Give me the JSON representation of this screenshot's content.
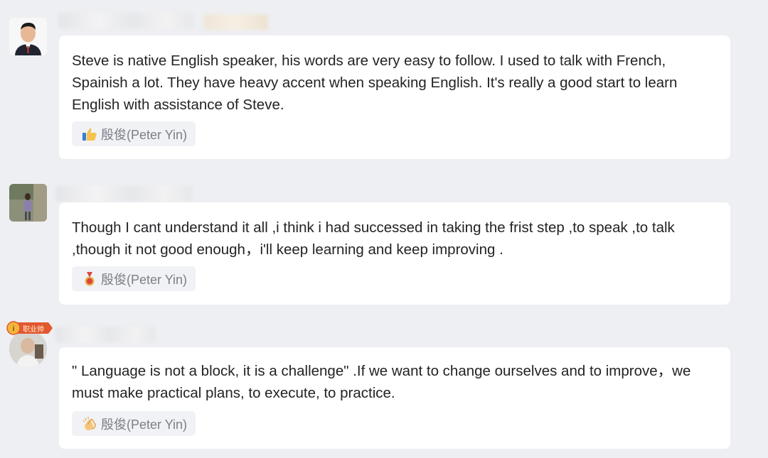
{
  "comments": [
    {
      "text": "Steve is native English speaker, his words are very easy to follow. I used to talk with French, Spainish a lot. They have heavy accent when speaking English. It's really a good start to learn English with assistance of Steve.",
      "reaction": {
        "icon": "thumbs-up-icon",
        "name": "殷俊(Peter Yin)"
      }
    },
    {
      "text": "Though I cant understand it all ,i  think i had successed in taking  the frist step ,to speak ,to talk ,though it not good enough，i'll keep learning and keep improving .",
      "reaction": {
        "icon": "medal-icon",
        "name": "殷俊(Peter Yin)"
      }
    },
    {
      "text": "\" Language is not a block, it is a challenge\" .If we want to change ourselves and to improve，we must make practical plans, to execute, to practice.",
      "reaction": {
        "icon": "clapping-hands-icon",
        "name": "殷俊(Peter Yin)"
      },
      "avatar_badge": "职业帅"
    }
  ]
}
